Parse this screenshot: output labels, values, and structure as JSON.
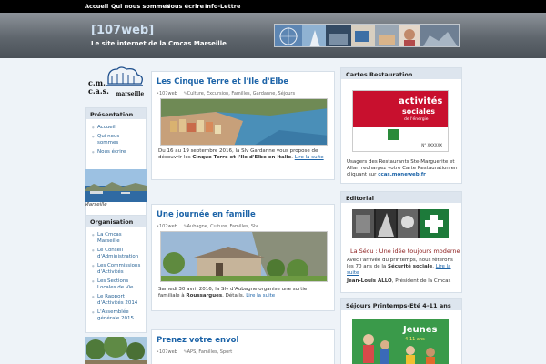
{
  "nav": {
    "items": [
      {
        "label": "Accueil"
      },
      {
        "label": "Qui nous sommes"
      },
      {
        "label": "Nous écrire"
      },
      {
        "label": "Info-Lettre"
      }
    ]
  },
  "header": {
    "title": "[107web]",
    "description": "Le site internet de la Cmcas Marseille"
  },
  "logo": {
    "line1": "c.m.",
    "line2": "c.a.s.",
    "city": "marseille"
  },
  "presentation": {
    "title": "Présentation",
    "items": [
      {
        "label": "Accueil"
      },
      {
        "label": "Qui nous sommes"
      },
      {
        "label": "Nous écrire"
      }
    ]
  },
  "marseille_photo": {
    "caption": "Marseille"
  },
  "organisation": {
    "title": "Organisation",
    "items": [
      {
        "label": "La Cmcas Marseille"
      },
      {
        "label": "Le Conseil d'Administration"
      },
      {
        "label": "Les Commissions d'Activités"
      },
      {
        "label": "Les Sections Locales de Vie"
      },
      {
        "label": "Le Rapport d'Activités 2014"
      },
      {
        "label": "L'Assemblée générale 2015"
      }
    ]
  },
  "posts": [
    {
      "title": "Les Cinque Terre et l'Ile d'Elbe",
      "author": "107web",
      "tags": "Culture, Excursion, Familles, Gardanne, Séjours",
      "excerpt_pre": "Du 16 au 19 septembre 2016, la Slv Gardanne vous propose de découvrir les ",
      "excerpt_bold": "Cinque Terre et l'Ile d'Elbe en Italie",
      "excerpt_post": ". ",
      "more": "Lire la suite"
    },
    {
      "title": "Une journée en famille",
      "author": "107web",
      "tags": "Aubagne, Culture, Familles, Slv",
      "excerpt_pre": "Samedi 30 avril 2016, la Slv d'Aubagne organise une sortie familiale à ",
      "excerpt_bold": "Roussargues",
      "excerpt_post": ". Détails. ",
      "more": "Lire la suite"
    },
    {
      "title": "Prenez votre envol",
      "author": "107web",
      "tags": "APS, Familles, Sport"
    }
  ],
  "restauration": {
    "title": "Cartes Restauration",
    "card_line1": "activités",
    "card_line2": "sociales",
    "card_sub": "de l'énergie",
    "card_number": "N° XXXXXX",
    "text": "Usagers des Restaurants Ste-Marguerite et Allar, rechargez votre Carte Restauration en cliquant sur ",
    "link": "ccas.moneweb.fr"
  },
  "editorial": {
    "title": "Editorial",
    "headline": "La Sécu : Une idée toujours moderne",
    "text_pre": "Avec l'arrivée du printemps, nous fêterons les 70 ans de la ",
    "text_bold": "Sécurité sociale",
    "text_post": ". ",
    "more": "Lire la suite",
    "author_name": "Jean-Louis ALLO",
    "author_role": ", Président de la Cmcas"
  },
  "sejours": {
    "title": "Séjours Printemps-Eté 4-11 ans",
    "poster_text": "Jeunes",
    "poster_sub": "4-11 ans"
  },
  "colors": {
    "nav_bg": "#000000",
    "link": "#1d64a8",
    "box_title_bg": "#dde5ee",
    "page_bg": "#eef3f8"
  }
}
